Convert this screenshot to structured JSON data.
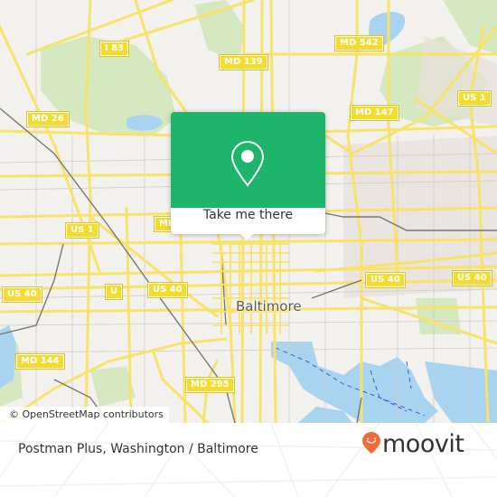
{
  "map": {
    "city_label": "Baltimore",
    "route_shields": [
      {
        "id": "i83",
        "label": "I 83"
      },
      {
        "id": "md139",
        "label": "MD 139"
      },
      {
        "id": "md542",
        "label": "MD 542"
      },
      {
        "id": "md26",
        "label": "MD 26"
      },
      {
        "id": "md147",
        "label": "MD 147"
      },
      {
        "id": "us1-east",
        "label": "US 1"
      },
      {
        "id": "us1-west",
        "label": "US 1"
      },
      {
        "id": "md-partial",
        "label": "MD"
      },
      {
        "id": "us40-far-west",
        "label": "US 40"
      },
      {
        "id": "us40-partial",
        "label": "U"
      },
      {
        "id": "us40-west",
        "label": "US 40"
      },
      {
        "id": "us40-east",
        "label": "US 40"
      },
      {
        "id": "us40-far-east",
        "label": "US 40"
      },
      {
        "id": "md144",
        "label": "MD 144"
      },
      {
        "id": "md295",
        "label": "MD 295"
      }
    ],
    "attribution": "© OpenStreetMap contributors",
    "colors": {
      "land": "#f2f1ee",
      "road": "#f7e36a",
      "park": "#d5e8c0",
      "water": "#a9d4f0",
      "rail": "#777777"
    }
  },
  "popup": {
    "icon": "location-pin-icon",
    "button_label": "Take me there",
    "color": "#1db56a"
  },
  "footer": {
    "place_title": "Postman Plus, Washington / Baltimore",
    "logo_text": "moovit",
    "logo_color": "#f06b3a"
  }
}
